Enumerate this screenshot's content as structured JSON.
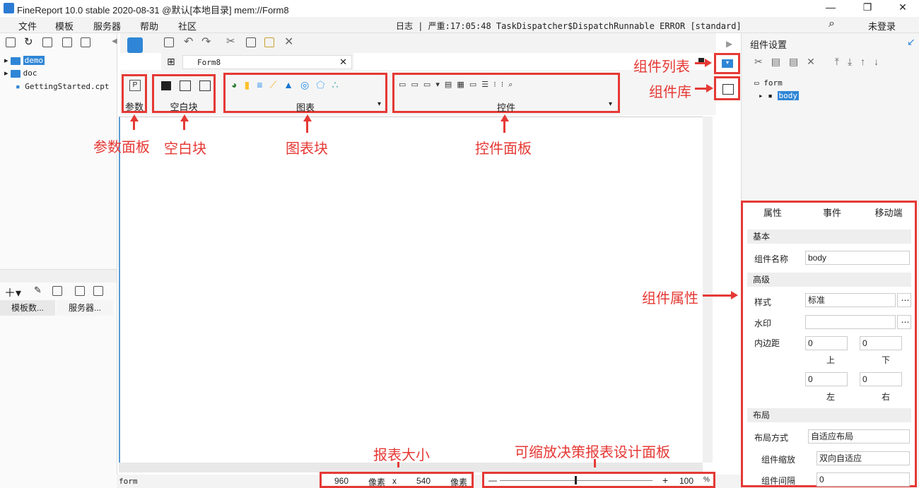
{
  "window": {
    "title": "FineReport 10.0 stable 2020-08-31 @默认[本地目录]    mem://Form8"
  },
  "menu": {
    "items": [
      "文件",
      "模板",
      "服务器",
      "帮助",
      "社区"
    ],
    "log": "日志 | 严重:17:05:48 TaskDispatcher$DispatchRunnable ERROR [standard]",
    "search_icon": "search-icon",
    "login": "未登录"
  },
  "tree": {
    "items": [
      "demo",
      "doc",
      "GettingStarted.cpt"
    ]
  },
  "left_tabs": [
    "模板数...",
    "服务器..."
  ],
  "doc_tab": {
    "label": "Form8"
  },
  "groups": {
    "param": "参数",
    "blank": "空白块",
    "chart": "图表",
    "control": "控件"
  },
  "annotations": {
    "param_panel": "参数面板",
    "blank_block": "空白块",
    "chart_block": "图表块",
    "control_panel": "控件面板",
    "component_list": "组件列表",
    "component_lib": "组件库",
    "component_props": "组件属性",
    "report_size": "报表大小",
    "zoom_panel": "可缩放决策报表设计面板"
  },
  "right": {
    "title": "组件设置",
    "tree": {
      "root": "form",
      "child": "body"
    },
    "tabs": [
      "属性",
      "事件",
      "移动端"
    ],
    "sections": {
      "basic": "基本",
      "advanced": "高级",
      "layout": "布局"
    },
    "fields": {
      "name_label": "组件名称",
      "name_value": "body",
      "style_label": "样式",
      "style_value": "标准",
      "watermark_label": "水印",
      "watermark_value": "",
      "padding_label": "内边距",
      "pad_top": "0",
      "pad_bottom": "0",
      "pad_left": "0",
      "pad_right": "0",
      "pad_top_label": "上",
      "pad_bottom_label": "下",
      "pad_left_label": "左",
      "pad_right_label": "右",
      "layout_mode_label": "布局方式",
      "layout_mode_value": "自适应布局",
      "scale_label": "组件缩放",
      "scale_value": "双向自适应",
      "gap_label": "组件间隔",
      "gap_value": "0"
    }
  },
  "status": {
    "form": "form",
    "width": "960",
    "unit1": "像素",
    "x": "x",
    "height": "540",
    "unit2": "像素",
    "zoom_minus": "—",
    "zoom_plus": "+",
    "zoom": "100",
    "pct": "%"
  }
}
